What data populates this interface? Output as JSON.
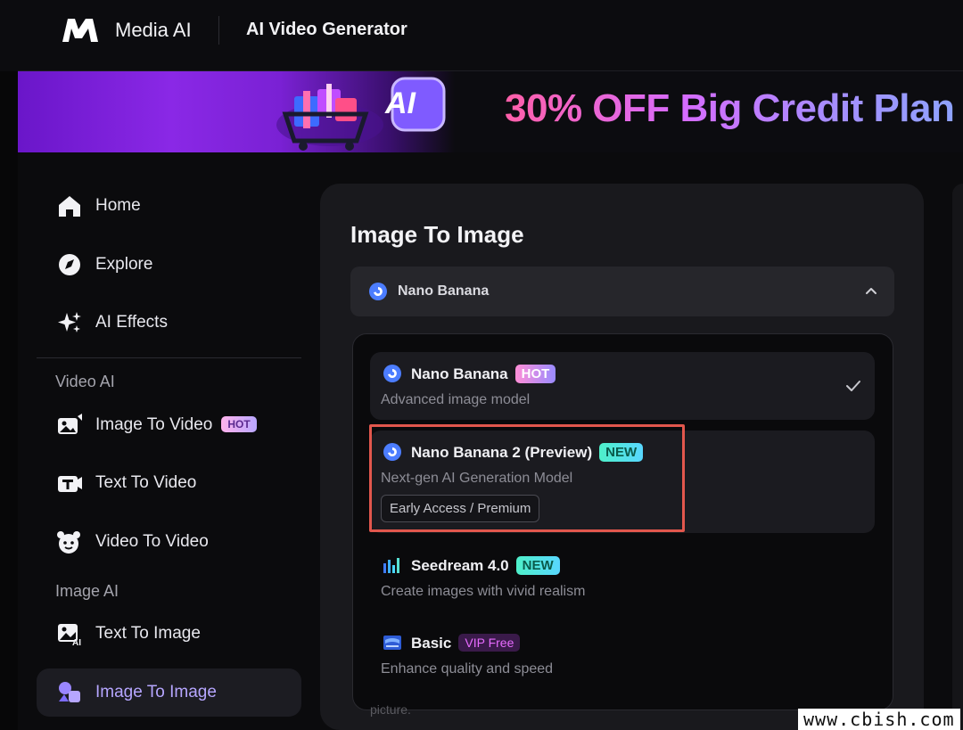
{
  "app": {
    "brand": "Media AI",
    "section_title": "AI Video Generator",
    "logo_text": "M"
  },
  "banner": {
    "text": "30% OFF Big Credit Plan",
    "art_label": "AI"
  },
  "sidebar": {
    "items": [
      {
        "label": "Home",
        "icon": "home-icon"
      },
      {
        "label": "Explore",
        "icon": "compass-icon"
      },
      {
        "label": "AI Effects",
        "icon": "sparkles-icon"
      }
    ],
    "video_section": "Video AI",
    "video_items": [
      {
        "label": "Image To Video",
        "badge": "HOT",
        "icon": "image-to-video-icon"
      },
      {
        "label": "Text To Video",
        "icon": "text-to-video-icon"
      },
      {
        "label": "Video To Video",
        "icon": "face-video-icon"
      }
    ],
    "image_section": "Image AI",
    "image_items": [
      {
        "label": "Text To Image",
        "icon": "text-to-image-icon"
      },
      {
        "label": "Image To Image",
        "icon": "image-to-image-icon",
        "active": true
      }
    ]
  },
  "main": {
    "title": "Image To Image",
    "selected_model": "Nano Banana",
    "options": [
      {
        "name": "Nano Banana",
        "badge": "HOT",
        "desc": "Advanced image model",
        "selected": true
      },
      {
        "name": "Nano Banana 2 (Preview)",
        "badge": "NEW",
        "desc": "Next-gen AI Generation Model",
        "tag": "Early Access / Premium"
      },
      {
        "name": "Seedream 4.0",
        "badge": "NEW",
        "desc": "Create images with vivid realism"
      },
      {
        "name": "Basic",
        "badge": "VIP Free",
        "desc": "Enhance quality and speed"
      }
    ],
    "behind_text": "picture."
  },
  "watermark": "www.cbish.com",
  "colors": {
    "accent": "#b6a6ff",
    "highlight": "#e2574d",
    "panel": "#19191d"
  }
}
